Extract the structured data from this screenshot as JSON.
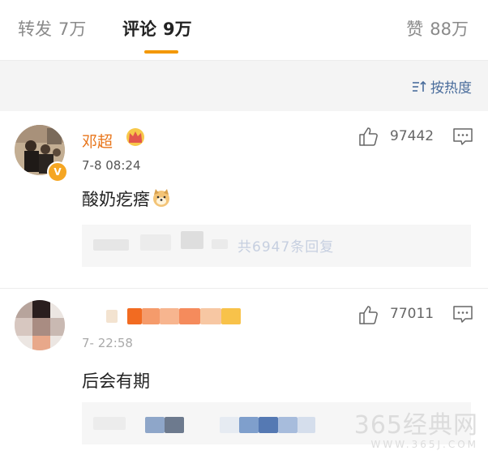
{
  "tabs": [
    {
      "label": "转发",
      "count": "7万"
    },
    {
      "label": "评论",
      "count": "9万"
    },
    {
      "label": "赞",
      "count": "88万"
    }
  ],
  "sort": {
    "label": "按热度",
    "icon": "sort-icon"
  },
  "comments": [
    {
      "username": "邓超",
      "verified_badge": "V",
      "timestamp": "7-8 08:24",
      "text": "酸奶疙瘩",
      "emoji": "doge-emoji",
      "like_count": "97442",
      "reply_summary": "共6947条回复"
    },
    {
      "username": "",
      "timestamp": "7-  22:58",
      "text": "后会有期",
      "like_count": "77011"
    }
  ],
  "watermark": {
    "main": "365经典网",
    "url": "WWW.365J.COM"
  },
  "colors": {
    "accent": "#f39800",
    "username": "#e8751a",
    "link": "#4a6d9c"
  }
}
